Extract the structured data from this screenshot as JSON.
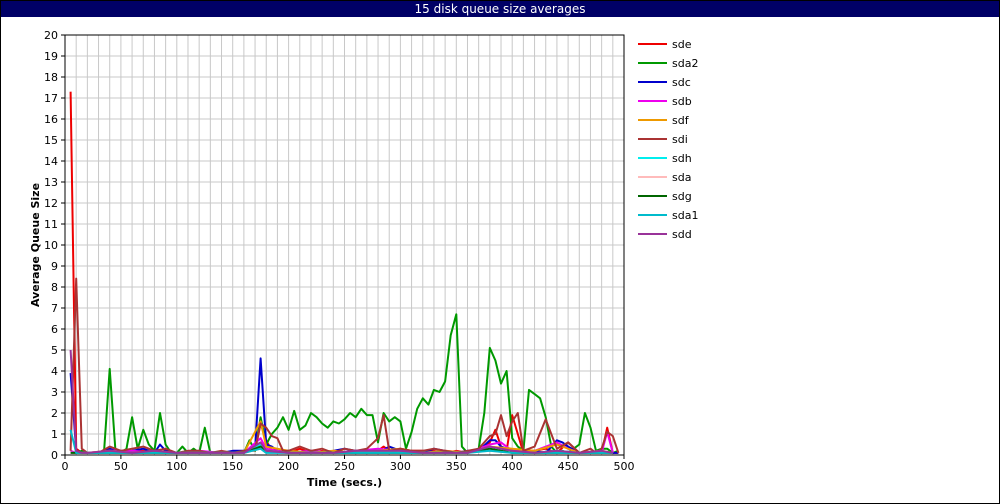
{
  "chart_data": {
    "type": "line",
    "title": "15 disk queue size averages",
    "xlabel": "Time (secs.)",
    "ylabel": "Average Queue Size",
    "xlim": [
      0,
      500
    ],
    "ylim": [
      0,
      20
    ],
    "xticks": [
      0,
      50,
      100,
      150,
      200,
      250,
      300,
      350,
      400,
      450,
      500
    ],
    "yticks": [
      0,
      1,
      2,
      3,
      4,
      5,
      6,
      7,
      8,
      9,
      10,
      11,
      12,
      13,
      14,
      15,
      16,
      17,
      18,
      19,
      20
    ],
    "grid": true,
    "legend_position": "right",
    "series": [
      {
        "name": "sde",
        "color": "#ee0000",
        "x": [
          5,
          10,
          15,
          20,
          30,
          40,
          50,
          60,
          70,
          80,
          90,
          100,
          110,
          120,
          130,
          140,
          150,
          160,
          170,
          175,
          180,
          185,
          190,
          200,
          210,
          220,
          230,
          240,
          250,
          260,
          270,
          280,
          285,
          290,
          300,
          310,
          320,
          330,
          340,
          350,
          360,
          370,
          380,
          385,
          390,
          395,
          400,
          410,
          420,
          430,
          440,
          450,
          460,
          470,
          480,
          485,
          490,
          495
        ],
        "y": [
          17.3,
          0.3,
          0.1,
          0.1,
          0.1,
          0.2,
          0.1,
          0.2,
          0.2,
          0.1,
          0.2,
          0.1,
          0.1,
          0.2,
          0.1,
          0.1,
          0.1,
          0.2,
          0.2,
          1.5,
          0.7,
          0.2,
          0.2,
          0.1,
          0.3,
          0.1,
          0.2,
          0.1,
          0.1,
          0.1,
          0.2,
          0.2,
          0.4,
          0.2,
          0.3,
          0.2,
          0.2,
          0.2,
          0.1,
          0.2,
          0.1,
          0.2,
          0.6,
          1.2,
          0.4,
          0.2,
          1.9,
          0.1,
          0.2,
          0.3,
          0.1,
          0.6,
          0.1,
          0.1,
          0.1,
          1.3,
          0.1,
          0.1
        ]
      },
      {
        "name": "sda2",
        "color": "#009900",
        "x": [
          5,
          10,
          15,
          20,
          30,
          35,
          40,
          45,
          50,
          55,
          60,
          65,
          70,
          75,
          80,
          85,
          90,
          95,
          100,
          105,
          110,
          115,
          120,
          125,
          130,
          140,
          150,
          160,
          165,
          170,
          175,
          180,
          185,
          190,
          195,
          200,
          205,
          210,
          215,
          220,
          225,
          230,
          235,
          240,
          245,
          250,
          255,
          260,
          265,
          270,
          275,
          280,
          285,
          290,
          295,
          300,
          305,
          310,
          315,
          320,
          325,
          330,
          335,
          340,
          345,
          350,
          355,
          360,
          365,
          370,
          375,
          380,
          385,
          390,
          395,
          400,
          405,
          410,
          415,
          420,
          425,
          430,
          435,
          440,
          445,
          450,
          455,
          460,
          465,
          470,
          475,
          480,
          485,
          490,
          495
        ],
        "y": [
          0.1,
          0.1,
          0.2,
          0.1,
          0.1,
          0.2,
          4.1,
          0.3,
          0.1,
          0.3,
          1.8,
          0.3,
          1.2,
          0.5,
          0.2,
          2.0,
          0.5,
          0.1,
          0.1,
          0.4,
          0.1,
          0.3,
          0.1,
          1.3,
          0.1,
          0.1,
          0.1,
          0.1,
          0.7,
          0.2,
          1.8,
          0.5,
          1.0,
          1.3,
          1.8,
          1.2,
          2.1,
          1.2,
          1.4,
          2.0,
          1.8,
          1.5,
          1.3,
          1.6,
          1.5,
          1.7,
          2.0,
          1.8,
          2.2,
          1.9,
          1.9,
          0.6,
          2.0,
          1.6,
          1.8,
          1.6,
          0.3,
          1.1,
          2.2,
          2.7,
          2.4,
          3.1,
          3.0,
          3.5,
          5.7,
          6.7,
          0.4,
          0.1,
          0.2,
          0.3,
          2.0,
          5.1,
          4.5,
          3.4,
          4.0,
          0.8,
          0.4,
          0.2,
          3.1,
          2.9,
          2.7,
          1.8,
          0.4,
          0.1,
          0.2,
          0.1,
          0.3,
          0.5,
          2.0,
          1.3,
          0.2,
          0.3,
          0.3,
          0.1,
          0.2
        ]
      },
      {
        "name": "sdc",
        "color": "#0000cc",
        "x": [
          5,
          10,
          15,
          20,
          30,
          40,
          50,
          60,
          70,
          80,
          85,
          90,
          100,
          110,
          120,
          130,
          140,
          150,
          160,
          170,
          175,
          180,
          185,
          190,
          200,
          210,
          220,
          230,
          240,
          250,
          260,
          270,
          280,
          290,
          300,
          310,
          320,
          330,
          340,
          350,
          360,
          370,
          380,
          385,
          390,
          400,
          410,
          420,
          430,
          440,
          445,
          450,
          460,
          470,
          480,
          490,
          495
        ],
        "y": [
          3.9,
          0.2,
          0.1,
          0.1,
          0.1,
          0.3,
          0.1,
          0.2,
          0.3,
          0.1,
          0.5,
          0.2,
          0.1,
          0.1,
          0.2,
          0.1,
          0.1,
          0.2,
          0.2,
          0.3,
          4.6,
          0.5,
          0.4,
          0.2,
          0.2,
          0.1,
          0.2,
          0.1,
          0.2,
          0.3,
          0.2,
          0.1,
          0.1,
          0.4,
          0.2,
          0.2,
          0.1,
          0.3,
          0.2,
          0.1,
          0.2,
          0.2,
          0.7,
          0.7,
          0.4,
          0.2,
          0.1,
          0.2,
          0.1,
          0.7,
          0.6,
          0.4,
          0.1,
          0.1,
          0.1,
          0.1,
          0.1
        ]
      },
      {
        "name": "sdb",
        "color": "#ee00ee",
        "x": [
          5,
          10,
          20,
          40,
          60,
          80,
          100,
          120,
          140,
          160,
          175,
          180,
          200,
          220,
          240,
          260,
          280,
          300,
          320,
          340,
          360,
          380,
          390,
          400,
          420,
          440,
          450,
          460,
          480,
          485,
          490
        ],
        "y": [
          0.2,
          0.1,
          0.1,
          0.2,
          0.2,
          0.1,
          0.1,
          0.2,
          0.1,
          0.1,
          0.8,
          0.3,
          0.1,
          0.2,
          0.1,
          0.2,
          0.3,
          0.2,
          0.1,
          0.2,
          0.1,
          0.5,
          0.6,
          0.2,
          0.2,
          0.6,
          0.3,
          0.1,
          0.1,
          1.1,
          0.1
        ]
      },
      {
        "name": "sdf",
        "color": "#ee9900",
        "x": [
          5,
          10,
          20,
          40,
          60,
          80,
          100,
          120,
          140,
          160,
          175,
          180,
          200,
          220,
          240,
          260,
          280,
          300,
          320,
          340,
          360,
          380,
          400,
          420,
          440,
          460,
          480,
          490
        ],
        "y": [
          0.1,
          0.1,
          0.1,
          0.2,
          0.1,
          0.2,
          0.1,
          0.1,
          0.1,
          0.1,
          1.6,
          0.4,
          0.2,
          0.1,
          0.2,
          0.1,
          0.2,
          0.3,
          0.1,
          0.2,
          0.1,
          0.4,
          0.3,
          0.2,
          0.5,
          0.1,
          0.2,
          0.1
        ]
      },
      {
        "name": "sdi",
        "color": "#aa3333",
        "x": [
          5,
          10,
          15,
          20,
          30,
          40,
          50,
          60,
          70,
          80,
          90,
          100,
          110,
          120,
          130,
          140,
          150,
          160,
          170,
          175,
          180,
          185,
          190,
          195,
          200,
          210,
          220,
          230,
          240,
          250,
          260,
          270,
          280,
          285,
          290,
          300,
          310,
          320,
          330,
          340,
          350,
          360,
          370,
          380,
          385,
          390,
          395,
          400,
          405,
          410,
          420,
          430,
          440,
          450,
          460,
          470,
          475,
          480,
          485,
          490,
          495
        ],
        "y": [
          0.2,
          8.4,
          0.3,
          0.1,
          0.1,
          0.4,
          0.2,
          0.3,
          0.4,
          0.2,
          0.3,
          0.1,
          0.2,
          0.2,
          0.1,
          0.2,
          0.1,
          0.2,
          0.3,
          1.5,
          1.3,
          0.9,
          0.8,
          0.2,
          0.2,
          0.4,
          0.2,
          0.3,
          0.1,
          0.3,
          0.2,
          0.3,
          0.8,
          1.9,
          0.2,
          0.3,
          0.2,
          0.2,
          0.3,
          0.2,
          0.1,
          0.2,
          0.3,
          0.9,
          1.0,
          1.9,
          0.9,
          1.6,
          2.0,
          0.2,
          0.4,
          1.7,
          0.3,
          0.6,
          0.1,
          0.3,
          0.1,
          0.3,
          1.1,
          0.9,
          0.1
        ]
      },
      {
        "name": "sdh",
        "color": "#00eeee",
        "x": [
          5,
          10,
          20,
          40,
          60,
          80,
          100,
          120,
          140,
          160,
          175,
          180,
          200,
          220,
          240,
          260,
          280,
          300,
          320,
          340,
          360,
          380,
          400,
          420,
          440,
          460,
          480,
          490
        ],
        "y": [
          0.1,
          0.1,
          0.1,
          0.1,
          0.1,
          0.1,
          0.1,
          0.1,
          0.1,
          0.1,
          0.5,
          0.2,
          0.1,
          0.1,
          0.1,
          0.1,
          0.2,
          0.1,
          0.1,
          0.1,
          0.1,
          0.3,
          0.1,
          0.1,
          0.2,
          0.1,
          0.1,
          0.1
        ]
      },
      {
        "name": "sda",
        "color": "#ffbbbb",
        "x": [
          5,
          10,
          20,
          40,
          60,
          80,
          100,
          120,
          140,
          160,
          175,
          180,
          200,
          220,
          240,
          260,
          280,
          300,
          320,
          340,
          360,
          380,
          400,
          420,
          440,
          460,
          480,
          490
        ],
        "y": [
          0.1,
          0.1,
          0.1,
          0.1,
          0.1,
          0.1,
          0.1,
          0.1,
          0.1,
          0.1,
          0.3,
          0.2,
          0.1,
          0.1,
          0.1,
          0.1,
          0.1,
          0.1,
          0.1,
          0.1,
          0.1,
          0.2,
          0.1,
          0.1,
          0.1,
          0.1,
          0.1,
          0.1
        ]
      },
      {
        "name": "sdg",
        "color": "#006600",
        "x": [
          5,
          10,
          20,
          40,
          60,
          80,
          100,
          120,
          140,
          160,
          175,
          180,
          200,
          220,
          240,
          260,
          280,
          300,
          320,
          340,
          360,
          380,
          400,
          420,
          440,
          460,
          480,
          490
        ],
        "y": [
          0.1,
          0.1,
          0.1,
          0.1,
          0.1,
          0.1,
          0.1,
          0.1,
          0.1,
          0.1,
          0.4,
          0.2,
          0.1,
          0.1,
          0.1,
          0.1,
          0.1,
          0.1,
          0.1,
          0.1,
          0.1,
          0.3,
          0.1,
          0.1,
          0.1,
          0.1,
          0.1,
          0.1
        ]
      },
      {
        "name": "sda1",
        "color": "#00bbcc",
        "x": [
          5,
          10,
          20,
          40,
          60,
          80,
          100,
          120,
          140,
          160,
          175,
          180,
          200,
          220,
          240,
          260,
          280,
          300,
          320,
          340,
          360,
          380,
          400,
          420,
          440,
          460,
          480,
          490
        ],
        "y": [
          1.2,
          0.1,
          0.1,
          0.1,
          0.1,
          0.1,
          0.1,
          0.1,
          0.1,
          0.1,
          0.3,
          0.1,
          0.1,
          0.1,
          0.1,
          0.1,
          0.1,
          0.1,
          0.1,
          0.1,
          0.1,
          0.2,
          0.1,
          0.1,
          0.1,
          0.1,
          0.1,
          0.1
        ]
      },
      {
        "name": "sdd",
        "color": "#993399",
        "x": [
          5,
          10,
          15,
          20,
          40,
          60,
          80,
          100,
          120,
          140,
          160,
          175,
          180,
          200,
          220,
          240,
          260,
          280,
          300,
          320,
          340,
          360,
          380,
          400,
          420,
          440,
          460,
          480,
          490
        ],
        "y": [
          5.0,
          0.2,
          0.1,
          0.1,
          0.2,
          0.1,
          0.2,
          0.1,
          0.1,
          0.1,
          0.1,
          0.6,
          0.2,
          0.1,
          0.1,
          0.1,
          0.2,
          0.2,
          0.2,
          0.1,
          0.1,
          0.1,
          0.4,
          0.2,
          0.1,
          0.2,
          0.1,
          0.2,
          0.1
        ]
      }
    ]
  }
}
